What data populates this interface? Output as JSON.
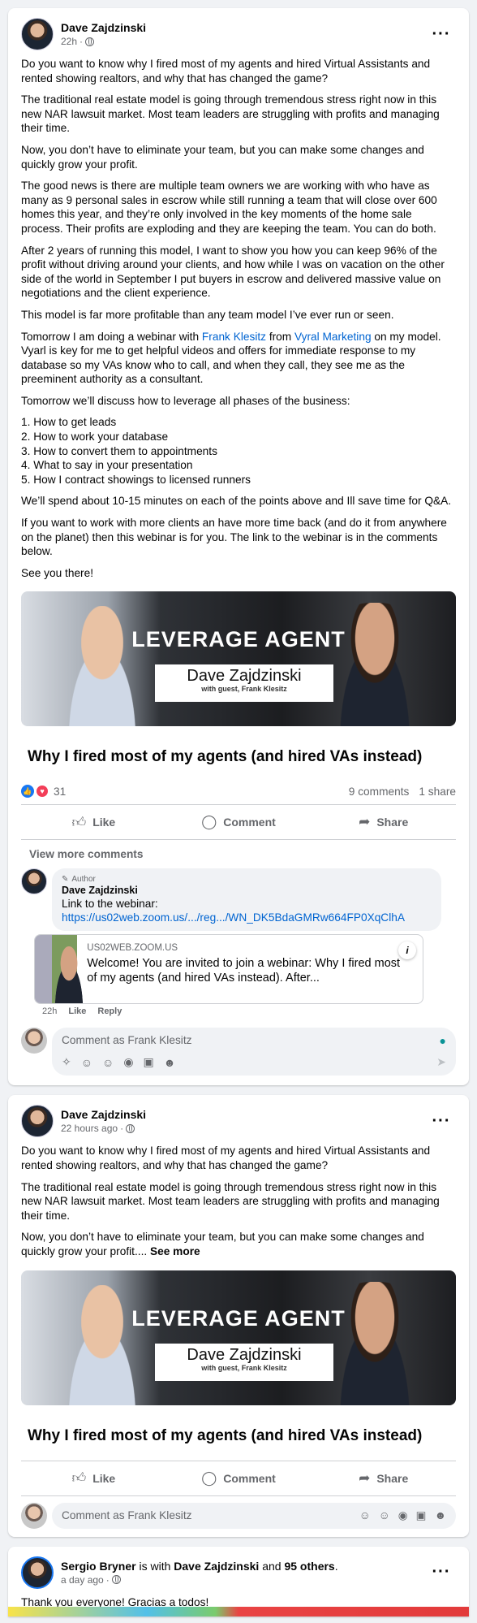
{
  "post1": {
    "author": "Dave Zajdzinski",
    "time": "22h",
    "paragraphs": [
      "Do you want to know why I fired most of my agents and hired Virtual Assistants and rented showing realtors, and why that has changed the game?",
      "The traditional real estate model is going through tremendous stress right now in this new NAR lawsuit market.  Most team leaders are struggling with profits and managing their time.",
      "Now, you don’t have to eliminate your team, but you can make some changes and quickly grow your profit.",
      "The good news is there are multiple team owners we are working with who have as many as 9 personal sales in escrow while still running a team that will close over 600 homes this year, and they’re only involved in the key moments of the home sale process.  Their profits are exploding and they are keeping the team.  You can do both.",
      "After 2 years of running this model, I want to show you how you can keep 96% of the profit without driving around your clients, and how while I was on vacation on the other side of the world in September I put buyers in escrow and delivered massive value on negotiations and the client experience.",
      "This model is far more profitable than any team model I’ve ever run or seen."
    ],
    "webinar_pre": "Tomorrow I am doing a webinar with ",
    "webinar_link1": "Frank Klesitz",
    "webinar_mid": " from ",
    "webinar_link2": "Vyral Marketing",
    "webinar_post": " on my model. Vyarl is key for me to get helpful videos and offers for immediate response to my database so my VAs know who to call, and when they call, they see me as the preeminent authority as a consultant.",
    "discuss_intro": "Tomorrow we’ll discuss how to leverage all phases of the business:",
    "list": [
      "1.  How to get leads",
      "2.  How to work your database",
      "3.  How to convert them to appointments",
      "4.  What to say in your presentation",
      "5.  How I contract showings to licensed runners"
    ],
    "after_list": [
      "We’ll spend about 10-15 minutes on each of the points above and Ill save time for Q&A.",
      "If you want to work with more clients an have more time back (and do it from anywhere on the planet) then this webinar is for you.  The link to the webinar is in the comments below.",
      "See you there!"
    ],
    "banner": {
      "brand": "LEVERAGE AGENT",
      "name": "Dave Zajdzinski",
      "guest": "with guest, Frank Klesitz"
    },
    "link_title": "Why I fired most of my agents (and hired VAs instead)",
    "reaction_count": "31",
    "comments_count": "9 comments",
    "shares_count": "1 share",
    "view_more": "View more comments",
    "comment": {
      "badge": "Author",
      "name": "Dave Zajdzinski",
      "text": "Link to the webinar:",
      "link": "https://us02web.zoom.us/.../reg.../WN_DK5BdaGMRw664FP0XqClhA",
      "preview_domain": "US02WEB.ZOOM.US",
      "preview_desc": "Welcome! You are invited to join a webinar: Why I fired most of my agents (and hired VAs instead). After...",
      "time": "22h",
      "like": "Like",
      "reply": "Reply"
    },
    "compose_placeholder": "Comment as Frank Klesitz"
  },
  "post2": {
    "author": "Dave Zajdzinski",
    "time": "22 hours ago",
    "paragraphs": [
      "Do you want to know why I fired most of my agents and hired Virtual Assistants and rented showing realtors, and why that has changed the game?",
      "The traditional real estate model is going through tremendous stress right now in this new NAR lawsuit market.  Most team leaders are struggling with profits and managing their time."
    ],
    "last_para": "Now, you don’t have to eliminate your team, but you can make some changes and quickly grow your profit....",
    "see_more": "See more",
    "banner": {
      "brand": "LEVERAGE AGENT",
      "name": "Dave Zajdzinski",
      "guest": "with guest, Frank Klesitz"
    },
    "link_title": "Why I fired most of my agents (and hired VAs instead)",
    "compose_placeholder": "Comment as Frank Klesitz"
  },
  "post3": {
    "author": "Sergio Bryner",
    "is_with": " is with ",
    "tagged": "Dave Zajdzinski",
    "and": " and ",
    "others": "95 others",
    "period": ".",
    "time": "a day ago",
    "text": "Thank you everyone! Gracias a todos!"
  },
  "actions": {
    "like": "Like",
    "comment": "Comment",
    "share": "Share"
  },
  "icons": {
    "like": "thumbs-up-icon",
    "comment": "speech-bubble-icon",
    "share": "share-arrow-icon"
  },
  "colors": {
    "link": "#0064d1",
    "like": "#1877f2",
    "love": "#f33e58"
  }
}
